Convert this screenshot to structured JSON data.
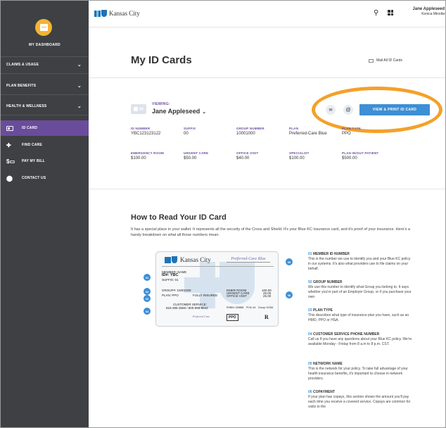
{
  "sidebar": {
    "dashboard_label": "MY DASHBOARD",
    "accordions": [
      {
        "label": "CLAIMS & USAGE"
      },
      {
        "label": "PLAN BENEFITS"
      },
      {
        "label": "HEALTH & WELLNESS"
      }
    ],
    "items": [
      {
        "label": "ID CARD"
      },
      {
        "label": "FIND CARE"
      },
      {
        "label": "PAY MY BILL"
      },
      {
        "label": "CONTACT US"
      }
    ]
  },
  "topbar": {
    "brand": "Kansas City",
    "user_name": "Jane Appleseed",
    "user_org": "Konica Minolta"
  },
  "page": {
    "title": "My ID Cards",
    "mail_all": "Mail All ID Cards"
  },
  "card_section": {
    "viewing_label": "VIEWING:",
    "viewing_name": "Jane Appleseed",
    "print_button": "VIEW & PRINT ID CARD",
    "row1": [
      {
        "label": "ID NUMBER",
        "value": "YBC123123122"
      },
      {
        "label": "SUFFIX",
        "value": "00"
      },
      {
        "label": "GROUP NUMBER",
        "value": "10001000"
      },
      {
        "label": "PLAN",
        "value": "Preferred-Care Blue"
      },
      {
        "label": "PLAN TYPE",
        "value": "PPO"
      }
    ],
    "row2": [
      {
        "label": "EMERGENCY ROOM",
        "value": "$100.00"
      },
      {
        "label": "URGENT CARE",
        "value": "$50.00"
      },
      {
        "label": "OFFICE VISIT",
        "value": "$40.00"
      },
      {
        "label": "SPECIALIST",
        "value": "$100.00"
      },
      {
        "label": "PLAN IN/OUT PATIENT",
        "value": "$500.00"
      }
    ]
  },
  "how_to": {
    "title": "How to Read Your ID Card",
    "intro": "It has a special place in your wallet. It represents all the security of the Cross and Shield. It's your Blue KC insurance card, and it's proof of your insurance. Here's a handy breakdown on what all those numbers mean.",
    "card": {
      "brand": "Kansas City",
      "plan": "Preferred-Care Blue",
      "member_name": "MEMBER: NAME",
      "id": "ID#: YBC",
      "suffix": "SUFFIX: 01",
      "group": "GROUP#: 10001000",
      "plan_line": "PLAN: PPO",
      "fully_insured": "FULLY INSURED",
      "er": "EMER ROOM",
      "er_val": "100.00",
      "uc": "URGENT CARE",
      "uc_val": "25.00",
      "ov": "OFFICE VISIT",
      "ov_val": "25.00",
      "cs_label": "CUSTOMER SERVICE:",
      "cs_phone": "816-395-3558 / 800-999-8842",
      "rx": "RXBIN: 003858",
      "pcn": "PCN: A4",
      "grp": "Group: KCBA",
      "pref": "Preferred Care",
      "ppo": "PPO",
      "r": "R"
    },
    "badges": [
      "01",
      "02",
      "03",
      "04",
      "05",
      "06"
    ],
    "legend": [
      {
        "num": "01",
        "title": "MEMBER ID NUMBER",
        "desc": "This is the number we use to identify you and your Blue KC policy in our systems. It's also what providers use to file claims on your behalf."
      },
      {
        "num": "02",
        "title": "GROUP NUMBER",
        "desc": "We use this number to identify what Group you belong to. It says whether you're part of an Employer Group, or if you purchase your own"
      },
      {
        "num": "03",
        "title": "PLAN TYPE",
        "desc": "This describes what type of insurance plan you have, such as an HMO, PPO or HSA."
      },
      {
        "num": "04",
        "title": "CUSTOMER SERVICE PHONE NUMBER",
        "desc": "Call us if you have any questions about your Blue KC policy. We're available Monday - Friday from 8 a.m to 8 p.m. CST."
      },
      {
        "num": "05",
        "title": "NETWORK NAME",
        "desc": "This is the network for your policy. To take full advantage of your health insurance benefits, it's important to choose in-network providers."
      },
      {
        "num": "06",
        "title": "COPAYMENT",
        "desc": "If your plan has copays, this section shows the amount you'll pay each time you receive a covered service. Copays are common for visits to the"
      }
    ]
  },
  "colors": {
    "sidebar_bg": "#3e4043",
    "active_item": "#6a4c9c",
    "accent_blue": "#3d8fd6",
    "highlight_ring": "#f3a12a",
    "label_purple": "#6a4c9c"
  }
}
